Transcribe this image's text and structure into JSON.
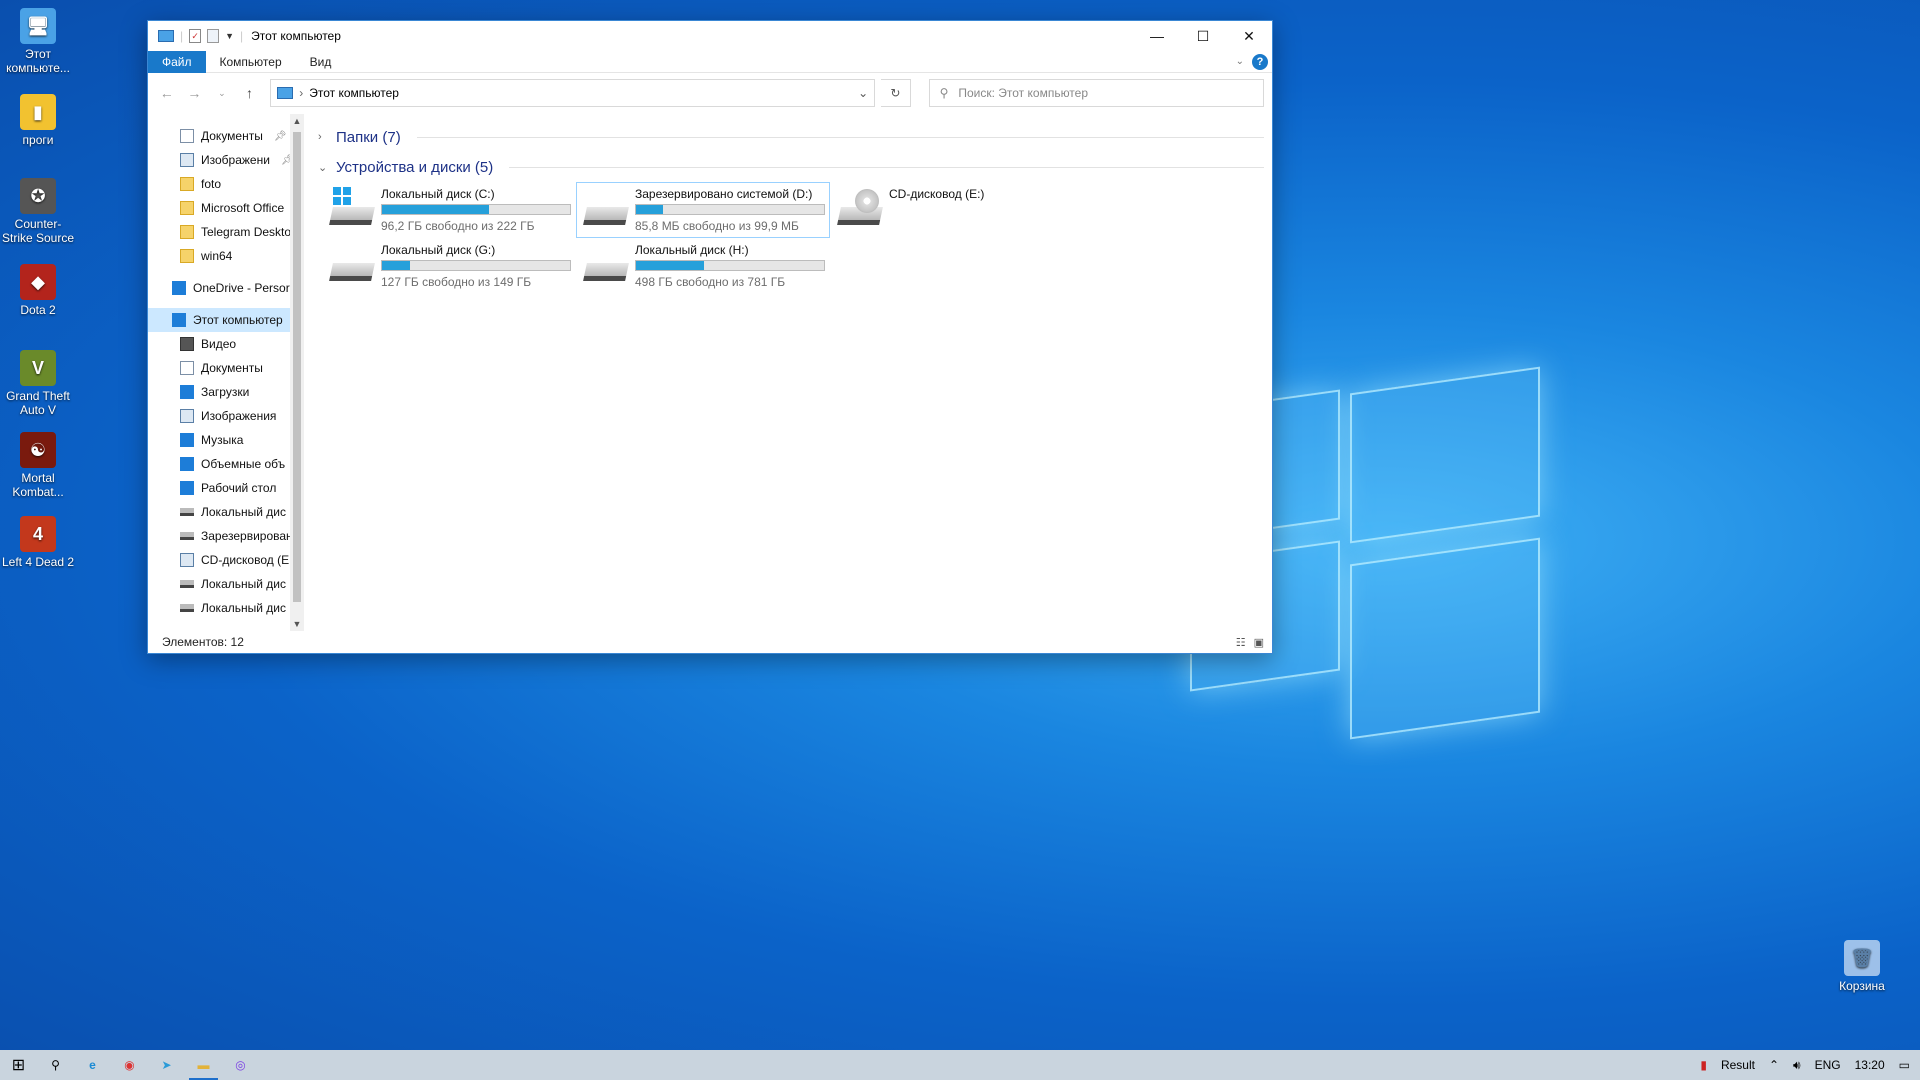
{
  "desktop": {
    "icons": [
      {
        "label": "Этот компьюте...",
        "color": "#4aa2e6",
        "glyph": "🖥"
      },
      {
        "label": "проги",
        "color": "#f2c230",
        "glyph": "▮"
      },
      {
        "label": "Counter-Strike Source",
        "color": "#555555",
        "glyph": "✪"
      },
      {
        "label": "Dota 2",
        "color": "#b3241c",
        "glyph": "◆"
      },
      {
        "label": "Grand Theft Auto V",
        "color": "#6a8a2a",
        "glyph": "V"
      },
      {
        "label": "Mortal Kombat...",
        "color": "#7a1a0e",
        "glyph": "☯"
      },
      {
        "label": "Left 4 Dead 2",
        "color": "#c3381c",
        "glyph": "4"
      }
    ],
    "recycle_bin": "Корзина"
  },
  "window": {
    "title": "Этот компьютер",
    "tabs": [
      "Файл",
      "Компьютер",
      "Вид"
    ],
    "address": "Этот компьютер",
    "search_placeholder": "Поиск: Этот компьютер",
    "status": "Элементов: 12"
  },
  "sidebar": {
    "items": [
      {
        "label": "Документы",
        "icon": "document-icon",
        "pinned": true
      },
      {
        "label": "Изображени",
        "icon": "pictures-icon",
        "pinned": true
      },
      {
        "label": "foto",
        "icon": "folder-icon"
      },
      {
        "label": "Microsoft Office",
        "icon": "folder-icon"
      },
      {
        "label": "Telegram Deskto",
        "icon": "folder-icon"
      },
      {
        "label": "win64",
        "icon": "folder-icon"
      },
      {
        "label": "OneDrive - Persor",
        "icon": "onedrive-icon"
      },
      {
        "label": "Этот компьютер",
        "icon": "computer-icon",
        "selected": true
      },
      {
        "label": "Видео",
        "icon": "video-icon"
      },
      {
        "label": "Документы",
        "icon": "document-icon"
      },
      {
        "label": "Загрузки",
        "icon": "download-icon"
      },
      {
        "label": "Изображения",
        "icon": "pictures-icon"
      },
      {
        "label": "Музыка",
        "icon": "music-icon"
      },
      {
        "label": "Объемные объ",
        "icon": "3d-objects-icon"
      },
      {
        "label": "Рабочий стол",
        "icon": "desktop-icon"
      },
      {
        "label": "Локальный дис",
        "icon": "drive-icon"
      },
      {
        "label": "Зарезервирован",
        "icon": "drive-icon"
      },
      {
        "label": "CD-дисковод (E",
        "icon": "cd-drive-icon"
      },
      {
        "label": "Локальный дис",
        "icon": "drive-icon"
      },
      {
        "label": "Локальный дис",
        "icon": "drive-icon"
      }
    ]
  },
  "groups": {
    "folders": "Папки (7)",
    "devices": "Устройства и диски (5)"
  },
  "drives": [
    {
      "name": "Локальный диск (C:)",
      "free": "96,2 ГБ свободно из 222 ГБ",
      "used_fraction": 0.567,
      "kind": "system"
    },
    {
      "name": "Зарезервировано системой (D:)",
      "free": "85,8 МБ свободно из 99,9 МБ",
      "used_fraction": 0.141,
      "kind": "hdd",
      "highlighted": true
    },
    {
      "name": "CD-дисковод (E:)",
      "free": "",
      "used_fraction": null,
      "kind": "cd"
    },
    {
      "name": "Локальный диск (G:)",
      "free": "127 ГБ свободно из 149 ГБ",
      "used_fraction": 0.148,
      "kind": "hdd"
    },
    {
      "name": "Локальный диск (H:)",
      "free": "498 ГБ свободно из 781 ГБ",
      "used_fraction": 0.362,
      "kind": "hdd"
    }
  ],
  "taskbar": {
    "tray": {
      "app": "Result",
      "lang": "ENG",
      "time": "13:20"
    }
  }
}
